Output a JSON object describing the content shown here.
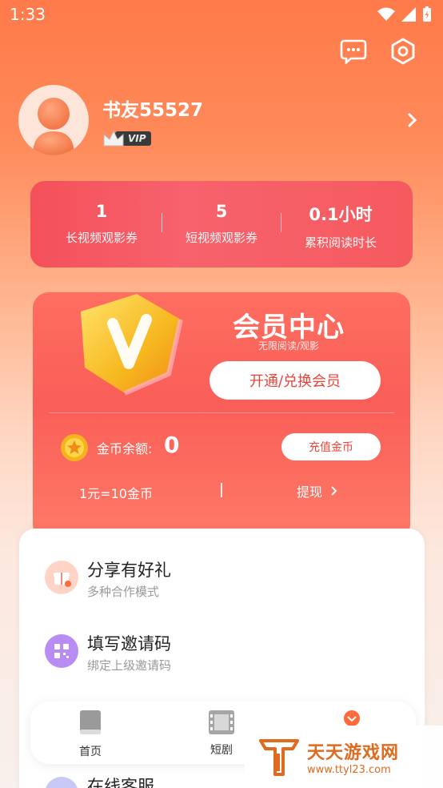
{
  "status_bar": {
    "time": "1:33"
  },
  "profile": {
    "username": "书友55527",
    "badge": "VIP"
  },
  "stats": [
    {
      "value": "1",
      "label": "长视频观影券"
    },
    {
      "value": "5",
      "label": "短视频观影券"
    },
    {
      "value": "0.1小时",
      "label": "累积阅读时长"
    }
  ],
  "member": {
    "title": "会员中心",
    "subtitle": "无限阅读/观影",
    "open_button": "开通/兑换会员",
    "coin_label": "金币余额:",
    "coin_value": "0",
    "recharge_button": "充值金币",
    "rate": "1元=10金币",
    "withdraw": "提现"
  },
  "menu": [
    {
      "title": "分享有好礼",
      "desc": "多种合作模式",
      "icon": "gift-icon"
    },
    {
      "title": "填写邀请码",
      "desc": "绑定上级邀请码",
      "icon": "qr-code-icon"
    },
    {
      "title": "在线客服",
      "icon": "headset-icon"
    }
  ],
  "nav": [
    {
      "label": "首页",
      "icon": "book-icon"
    },
    {
      "label": "短剧",
      "icon": "film-icon"
    },
    {
      "label": "",
      "icon": "profile-icon"
    }
  ],
  "watermark": {
    "title": "天天游戏网",
    "url": "www.ttyl23.com"
  },
  "colors": {
    "accent": "#ff7a4a",
    "card_red": "#f4505a",
    "button_text": "#e9443a"
  }
}
